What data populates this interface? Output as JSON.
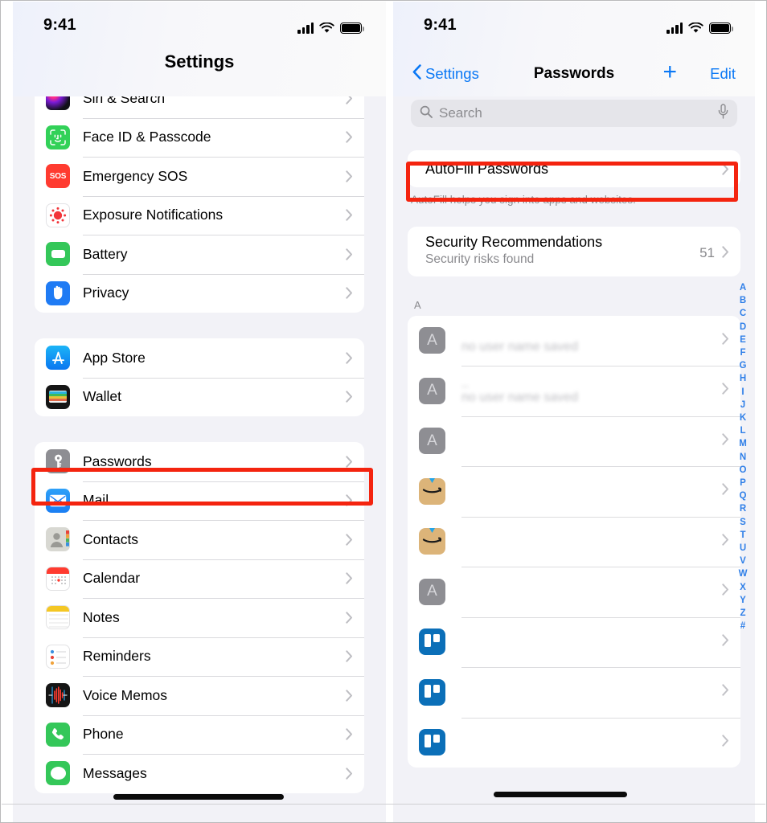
{
  "left_phone": {
    "status_bar": {
      "time": "9:41",
      "cellular": "signal-bars-icon",
      "wifi": "wifi-icon",
      "battery": "battery-icon"
    },
    "nav_title": "Settings",
    "groups": [
      {
        "items": [
          {
            "label": "Siri & Search",
            "icon": "siri-icon"
          },
          {
            "label": "Face ID & Passcode",
            "icon": "face-id-icon"
          },
          {
            "label": "Emergency SOS",
            "icon": "sos-icon",
            "icon_text": "SOS"
          },
          {
            "label": "Exposure Notifications",
            "icon": "exposure-notifications-icon"
          },
          {
            "label": "Battery",
            "icon": "battery-app-icon"
          },
          {
            "label": "Privacy",
            "icon": "privacy-hand-icon"
          }
        ]
      },
      {
        "items": [
          {
            "label": "App Store",
            "icon": "app-store-icon"
          },
          {
            "label": "Wallet",
            "icon": "wallet-icon"
          }
        ]
      },
      {
        "items": [
          {
            "label": "Passwords",
            "icon": "passwords-key-icon",
            "highlighted": true
          },
          {
            "label": "Mail",
            "icon": "mail-icon"
          },
          {
            "label": "Contacts",
            "icon": "contacts-icon"
          },
          {
            "label": "Calendar",
            "icon": "calendar-icon"
          },
          {
            "label": "Notes",
            "icon": "notes-icon"
          },
          {
            "label": "Reminders",
            "icon": "reminders-icon"
          },
          {
            "label": "Voice Memos",
            "icon": "voice-memos-icon"
          },
          {
            "label": "Phone",
            "icon": "phone-icon"
          },
          {
            "label": "Messages",
            "icon": "messages-icon"
          }
        ]
      }
    ]
  },
  "right_phone": {
    "status_bar": {
      "time": "9:41",
      "cellular": "signal-bars-icon",
      "wifi": "wifi-icon",
      "battery": "battery-icon"
    },
    "nav": {
      "back_label": "Settings",
      "title": "Passwords",
      "add_label": "+",
      "edit_label": "Edit"
    },
    "search": {
      "placeholder": "Search",
      "icon": "search-icon",
      "dictation_icon": "microphone-icon"
    },
    "autofill": {
      "label": "AutoFill Passwords",
      "footnote": "AutoFill helps you sign into apps and websites.",
      "highlighted": true
    },
    "security": {
      "title": "Security Recommendations",
      "subtitle": "Security risks found",
      "count": "51"
    },
    "section_header": "A",
    "entries": [
      {
        "icon": "generic-letter-a-icon",
        "icon_text": "A",
        "title": "",
        "subtitle": "no user name saved"
      },
      {
        "icon": "generic-letter-a-icon",
        "icon_text": "A",
        "title": "..",
        "subtitle": "no user name saved"
      },
      {
        "icon": "generic-letter-a-icon",
        "icon_text": "A",
        "title": "",
        "subtitle": ""
      },
      {
        "icon": "amazon-icon",
        "icon_text": "",
        "title": "",
        "subtitle": ""
      },
      {
        "icon": "amazon-icon",
        "icon_text": "",
        "title": "",
        "subtitle": ""
      },
      {
        "icon": "generic-letter-a-icon",
        "icon_text": "A",
        "title": "",
        "subtitle": ""
      },
      {
        "icon": "trello-icon",
        "icon_text": "",
        "title": "",
        "subtitle": ""
      },
      {
        "icon": "trello-icon",
        "icon_text": "",
        "title": "",
        "subtitle": ""
      },
      {
        "icon": "trello-icon",
        "icon_text": "",
        "title": "",
        "subtitle": ""
      }
    ],
    "alpha_index": [
      "A",
      "B",
      "C",
      "D",
      "E",
      "F",
      "G",
      "H",
      "I",
      "J",
      "K",
      "L",
      "M",
      "N",
      "O",
      "P",
      "Q",
      "R",
      "S",
      "T",
      "U",
      "V",
      "W",
      "X",
      "Y",
      "Z",
      "#"
    ]
  },
  "colors": {
    "highlight_red": "#f4240f",
    "accent_blue": "#0a78f5",
    "index_blue": "#2f7fe8",
    "background_gray": "#f2f2f7",
    "secondary_text": "#8a8a8e"
  }
}
